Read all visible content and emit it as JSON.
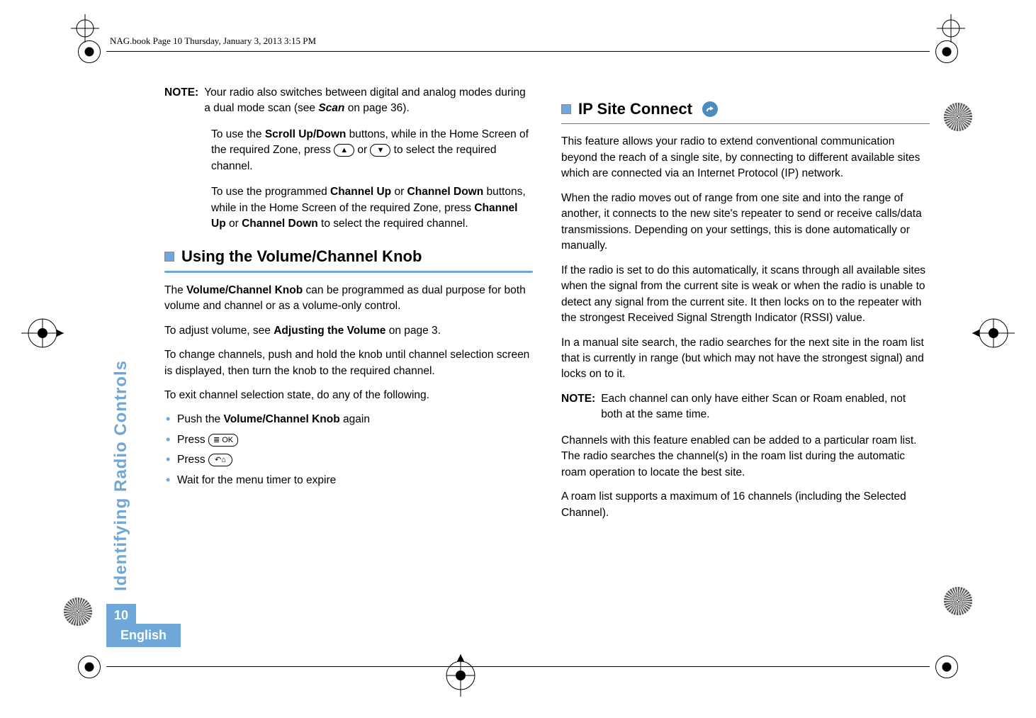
{
  "header": {
    "doc_info": "NAG.book  Page 10  Thursday, January 3, 2013  3:15 PM"
  },
  "sidebar": {
    "section_label": "Identifying Radio Controls",
    "page_number": "10",
    "language": "English"
  },
  "left": {
    "note_label": "NOTE:",
    "note_p1_a": "Your radio also switches between digital and analog modes during a dual mode scan (see ",
    "note_p1_scan": "Scan",
    "note_p1_b": " on page 36).",
    "note_p2_a": "To use the ",
    "note_p2_scroll": "Scroll Up/Down",
    "note_p2_b": " buttons, while in the Home Screen of the required Zone, press ",
    "note_p2_c": " or ",
    "note_p2_d": " to select the required channel.",
    "note_p3_a": "To use the programmed ",
    "note_p3_cu": "Channel Up",
    "note_p3_b": " or ",
    "note_p3_cd": "Channel Down",
    "note_p3_c": " buttons, while in the Home Screen of the required Zone, press ",
    "note_p3_cu2": "Channel Up",
    "note_p3_d": " or ",
    "note_p3_cd2": "Channel Down",
    "note_p3_e": " to select the required channel.",
    "h2": "Using the Volume/Channel Knob",
    "p1_a": "The ",
    "p1_vck": "Volume/Channel Knob",
    "p1_b": " can be programmed as dual purpose for both volume and channel or as a volume-only control.",
    "p2_a": "To adjust volume, see ",
    "p2_av": "Adjusting the Volume",
    "p2_b": " on page 3.",
    "p3": "To change channels, push and hold the knob until channel selection screen is displayed, then turn the knob to the required channel.",
    "p4": "To exit channel selection state, do any of the following.",
    "li1_a": "Push the ",
    "li1_vck": "Volume/Channel Knob",
    "li1_b": " again",
    "li2": "Press ",
    "li3": "Press ",
    "li4": "Wait for the menu timer to expire",
    "key_up": "▲",
    "key_down": "▼",
    "key_ok": "≣ OK",
    "key_back": "↶⌂"
  },
  "right": {
    "h2": "IP Site Connect",
    "p1": "This feature allows your radio to extend conventional communication beyond the reach of a single site, by connecting to different available sites which are connected via an Internet Protocol (IP) network.",
    "p2": "When the radio moves out of range from one site and into the range of another, it connects to the new site's repeater to send or receive calls/data transmissions. Depending on your settings, this is done automatically or manually.",
    "p3": "If the radio is set to do this automatically, it scans through all available sites when the signal from the current site is weak or when the radio is unable to detect any signal from the current site. It then locks on to the repeater with the strongest Received Signal Strength Indicator (RSSI) value.",
    "p4": "In a manual site search, the radio searches for the next site in the roam list that is currently in range (but which may not have the strongest signal) and locks on to it.",
    "note_label": "NOTE:",
    "note_body": "Each channel can only have either Scan or Roam enabled, not both at the same time.",
    "p5": "Channels with this feature enabled can be added to a particular roam list. The radio searches the channel(s) in the roam list during the automatic roam operation to locate the best site.",
    "p6": "A roam list supports a maximum of 16 channels (including the Selected Channel)."
  }
}
